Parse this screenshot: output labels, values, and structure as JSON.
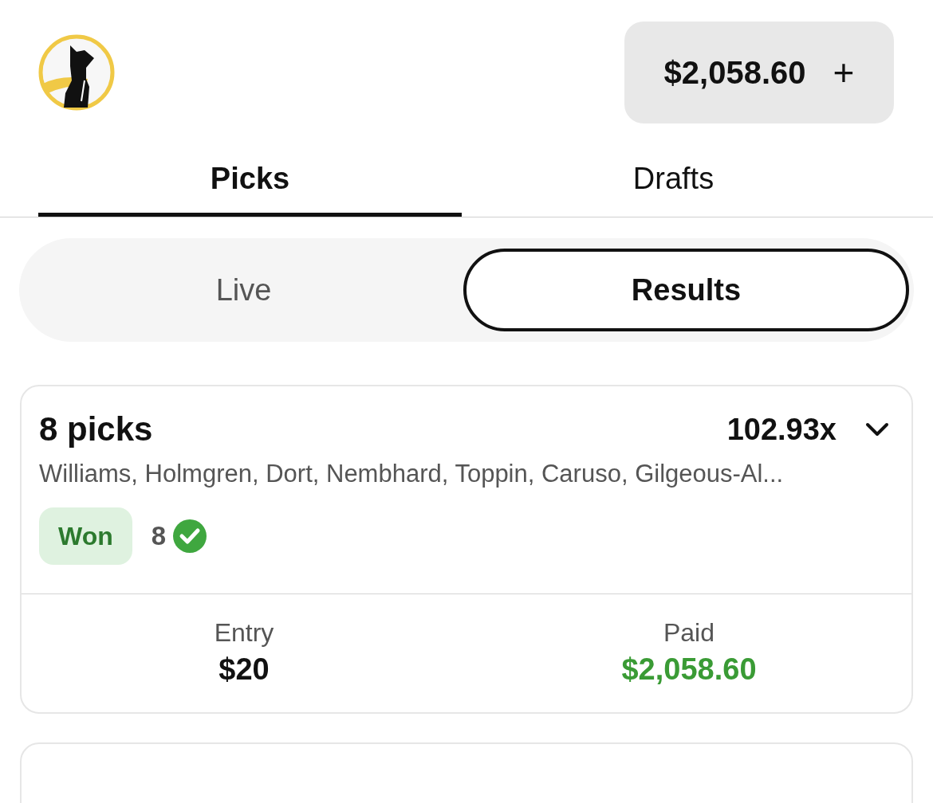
{
  "header": {
    "balance": "$2,058.60",
    "add_label": "+"
  },
  "tabs": [
    {
      "label": "Picks",
      "selected": true
    },
    {
      "label": "Drafts",
      "selected": false
    }
  ],
  "segments": [
    {
      "label": "Live",
      "selected": false
    },
    {
      "label": "Results",
      "selected": true
    }
  ],
  "cards": [
    {
      "title": "8 picks",
      "multiplier": "102.93x",
      "players": "Williams, Holmgren, Dort, Nembhard, Toppin, Caruso, Gilgeous-Al...",
      "status": {
        "kind": "won",
        "label": "Won"
      },
      "correct": "8",
      "entry_label": "Entry",
      "entry": "$20",
      "paid_label": "Paid",
      "paid": "$2,058.60"
    }
  ]
}
